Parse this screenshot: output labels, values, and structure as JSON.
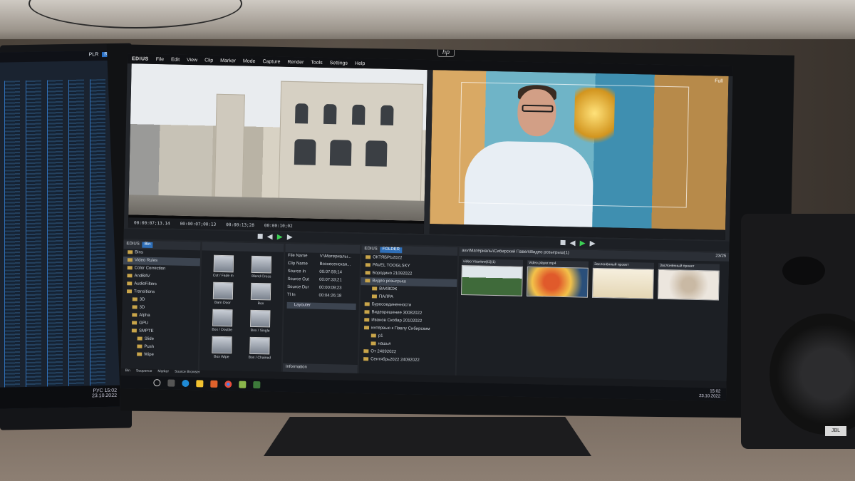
{
  "app": {
    "brand": "EDIUS",
    "menu": [
      "File",
      "Edit",
      "View",
      "Clip",
      "Marker",
      "Mode",
      "Capture",
      "Render",
      "Tools",
      "Settings",
      "Help"
    ]
  },
  "left_monitor": {
    "plr": "PLR",
    "rec": "REC",
    "clock_time": "15:02",
    "clock_date": "23.10.2022",
    "lang": "РУС"
  },
  "monitor_brand": "hp",
  "player": {
    "timecodes": [
      "00:00:07;13.14",
      "00:00:07;00:13",
      "00:00:13;28",
      "00:00:10;02"
    ]
  },
  "recorder": {
    "label": "Full"
  },
  "bin": {
    "tabs": [
      "EDIUS",
      "Bin"
    ],
    "tree_items": [
      "Bins",
      "Video Rules",
      "Color Correction",
      "AndBAV",
      "AudioFilters",
      "Transitions",
      "3D",
      "3D",
      "Alpha",
      "GPU",
      "SMPTE",
      "Slide",
      "Push",
      "Wipe",
      "Slide"
    ],
    "effects": [
      "Cut / Fade In",
      "Blend Cross",
      "Barn Door",
      "Box",
      "Box / Double",
      "Box / Single",
      "Box Wipe",
      "Box / Chained"
    ]
  },
  "info": {
    "rows": [
      {
        "k": "File Name",
        "v": "V:\\Материалы..."
      },
      {
        "k": "Clip Name",
        "v": "Вознесенская..."
      },
      {
        "k": "Source In",
        "v": "00:07:59;14"
      },
      {
        "k": "Source Out",
        "v": "00:07:33;21"
      },
      {
        "k": "Source Dur",
        "v": "00:00:09;23"
      },
      {
        "k": "Tl In",
        "v": "00:04:26;18"
      }
    ],
    "layer": "Layouter",
    "tab": "Information"
  },
  "folder": {
    "tabs": [
      "EDIUS",
      "FOLDER"
    ],
    "items": [
      "ОКТЯБРЬ2022",
      "PAVEL TOOGLSKY",
      "Бородино 21092022",
      "Видео розыгрыш",
      "ВАКВОЖ",
      "ПАЛРА",
      "Буросоединенности",
      "Видеорешение 30082022",
      "Иванов Скобар 20102022",
      "интервью к Павлу Сибирским",
      "p1",
      "нашья",
      "От 24092022",
      "Сентябрь2022 24092022"
    ]
  },
  "thumbs": {
    "path": "asv\\Материалы\\Сибирский Павел\\Видео розыгрыш(1)",
    "count": "23/25",
    "items": [
      {
        "title": "video.Vsaview(t1)(1)"
      },
      {
        "title": "Video.player.mp4"
      },
      {
        "title": "Заслонённый проект"
      },
      {
        "title": "Заслонённый проект"
      }
    ],
    "tabs": [
      "Bin",
      "Sequence",
      "Marker",
      "Source Browser"
    ]
  },
  "taskbar": {
    "clock_time": "15:02",
    "clock_date": "23.10.2022"
  },
  "speaker_badge": "JBL",
  "colors": {
    "accent": "#2f6fb8",
    "play": "#3ccf54",
    "folder": "#c9a54a"
  }
}
